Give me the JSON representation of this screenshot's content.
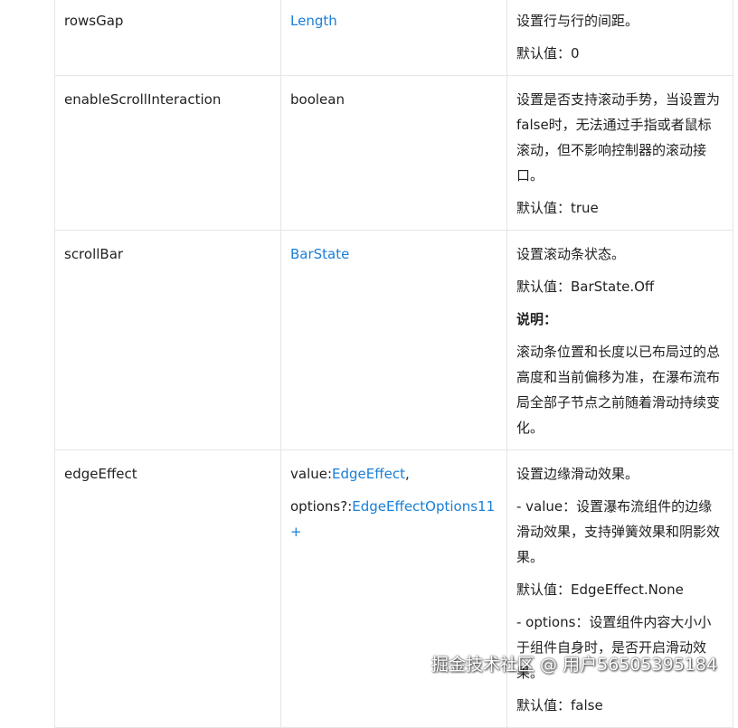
{
  "rows": [
    {
      "name": "rowsGap",
      "type": [
        {
          "text": "Length",
          "link": true
        }
      ],
      "desc": [
        {
          "text": "设置行与行的间距。"
        },
        {
          "text": "默认值：0"
        }
      ]
    },
    {
      "name": "enableScrollInteraction",
      "type": [
        {
          "text": "boolean",
          "link": false
        }
      ],
      "desc": [
        {
          "text": "设置是否支持滚动手势，当设置为false时，无法通过手指或者鼠标滚动，但不影响控制器的滚动接口。"
        },
        {
          "text": "默认值：true"
        }
      ]
    },
    {
      "name": "scrollBar",
      "type": [
        {
          "text": "BarState",
          "link": true
        }
      ],
      "desc": [
        {
          "text": "设置滚动条状态。"
        },
        {
          "text": "默认值：BarState.Off"
        },
        {
          "text": "说明：",
          "bold": true
        },
        {
          "text": "滚动条位置和长度以已布局过的总高度和当前偏移为准，在瀑布流布局全部子节点之前随着滑动持续变化。"
        }
      ]
    },
    {
      "name": "edgeEffect",
      "type_lines": [
        {
          "prefix": "value:",
          "link_text": "EdgeEffect",
          "suffix": ","
        },
        {
          "prefix": "options?:",
          "link_text": "EdgeEffectOptions11+",
          "suffix": ""
        }
      ],
      "desc": [
        {
          "text": "设置边缘滑动效果。"
        },
        {
          "text": "- value：设置瀑布流组件的边缘滑动效果，支持弹簧效果和阴影效果。"
        },
        {
          "text": "默认值：EdgeEffect.None"
        },
        {
          "text": "- options：设置组件内容大小小于组件自身时，是否开启滑动效果。"
        },
        {
          "text": "默认值：false"
        }
      ]
    }
  ],
  "watermark": "掘金技术社区 @ 用户56505395184",
  "colors": {
    "link": "#1a7fd6",
    "border": "#e6e6e6",
    "text": "#1f1f1f"
  }
}
